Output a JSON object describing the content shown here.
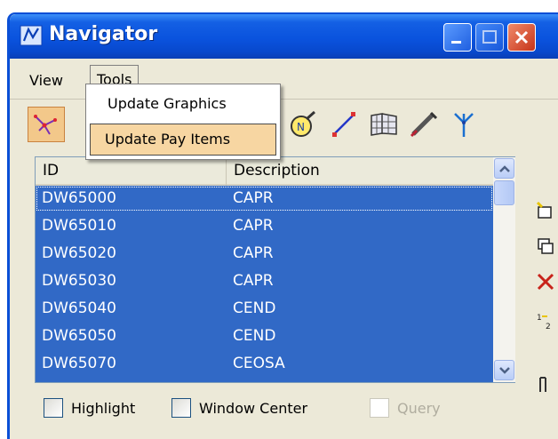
{
  "window": {
    "title": "Navigator"
  },
  "menubar": {
    "view": "View",
    "tools": "Tools"
  },
  "tools_menu": {
    "items": [
      "Update Graphics",
      "Update Pay Items"
    ],
    "highlighted": "Update Pay Items"
  },
  "list": {
    "columns": [
      "ID",
      "Description"
    ],
    "rows": [
      {
        "id": "DW65000",
        "desc": "CAPR"
      },
      {
        "id": "DW65010",
        "desc": "CAPR"
      },
      {
        "id": "DW65020",
        "desc": "CAPR"
      },
      {
        "id": "DW65030",
        "desc": "CAPR"
      },
      {
        "id": "DW65040",
        "desc": "CEND"
      },
      {
        "id": "DW65050",
        "desc": "CEND"
      },
      {
        "id": "DW65070",
        "desc": "CEOSA"
      }
    ]
  },
  "options": {
    "highlight": "Highlight",
    "window_center": "Window Center",
    "query": "Query"
  },
  "colors": {
    "title_blue": "#0a53de",
    "selection": "#3169c6",
    "menu_highlight": "#f7d6a2",
    "close_red": "#c6341a"
  },
  "icons": {
    "toolbar": [
      "network-icon",
      "north-arrow-icon",
      "line-icon",
      "grid-book-icon",
      "brush-icon",
      "branch-icon"
    ],
    "side": [
      "new-item-icon",
      "copy-icon",
      "delete-icon",
      "renumber-icon",
      "column-icon"
    ]
  }
}
